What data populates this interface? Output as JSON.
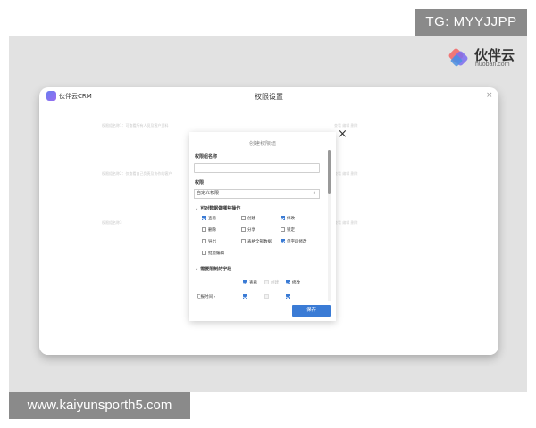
{
  "watermark": {
    "tg_tag": "TG: MYYJJPP",
    "url_tag": "www.kaiyunsporth5.com"
  },
  "brand": {
    "name": "伙伴云",
    "domain": "huoban.com"
  },
  "window": {
    "app_name": "伙伴云CRM",
    "title": "权限设置",
    "close_symbol": "×",
    "background_rows": [
      {
        "left": "权限组名称1：可查看所有人员及客户资料",
        "right": "查看 编辑 删除"
      },
      {
        "left": "权限组名称2：仅查看自己负责及协作的客户",
        "right": "查看 编辑 删除"
      },
      {
        "left": "权限组名称3",
        "right": "查看 编辑 删除"
      }
    ]
  },
  "modal": {
    "title": "创建权限组",
    "close_symbol": "×",
    "name_label": "权限组名称",
    "name_value": "",
    "permission_label": "权限",
    "permission_value": "自定义权限",
    "section_ops": "可对数据做哪些操作",
    "ops": [
      {
        "label": "查看",
        "checked": true
      },
      {
        "label": "创建",
        "checked": false
      },
      {
        "label": "修改",
        "checked": true
      },
      {
        "label": "删除",
        "checked": false
      },
      {
        "label": "分享",
        "checked": false
      },
      {
        "label": "锁定",
        "checked": false
      },
      {
        "label": "导出",
        "checked": false
      },
      {
        "label": "表格全部数据",
        "checked": false
      },
      {
        "label": "单字段修改",
        "checked": true
      },
      {
        "label": "批量编辑",
        "checked": false
      }
    ],
    "section_fields": "需要限制的字段",
    "field_headers": [
      {
        "label": "查看",
        "checked": true
      },
      {
        "label": "创建",
        "checked": false
      },
      {
        "label": "修改",
        "checked": true
      }
    ],
    "field_row_label": "汇报时间 ›",
    "save_label": "保存"
  },
  "colors": {
    "primary": "#3a7bd5",
    "backdrop": "#e2e2e2"
  }
}
